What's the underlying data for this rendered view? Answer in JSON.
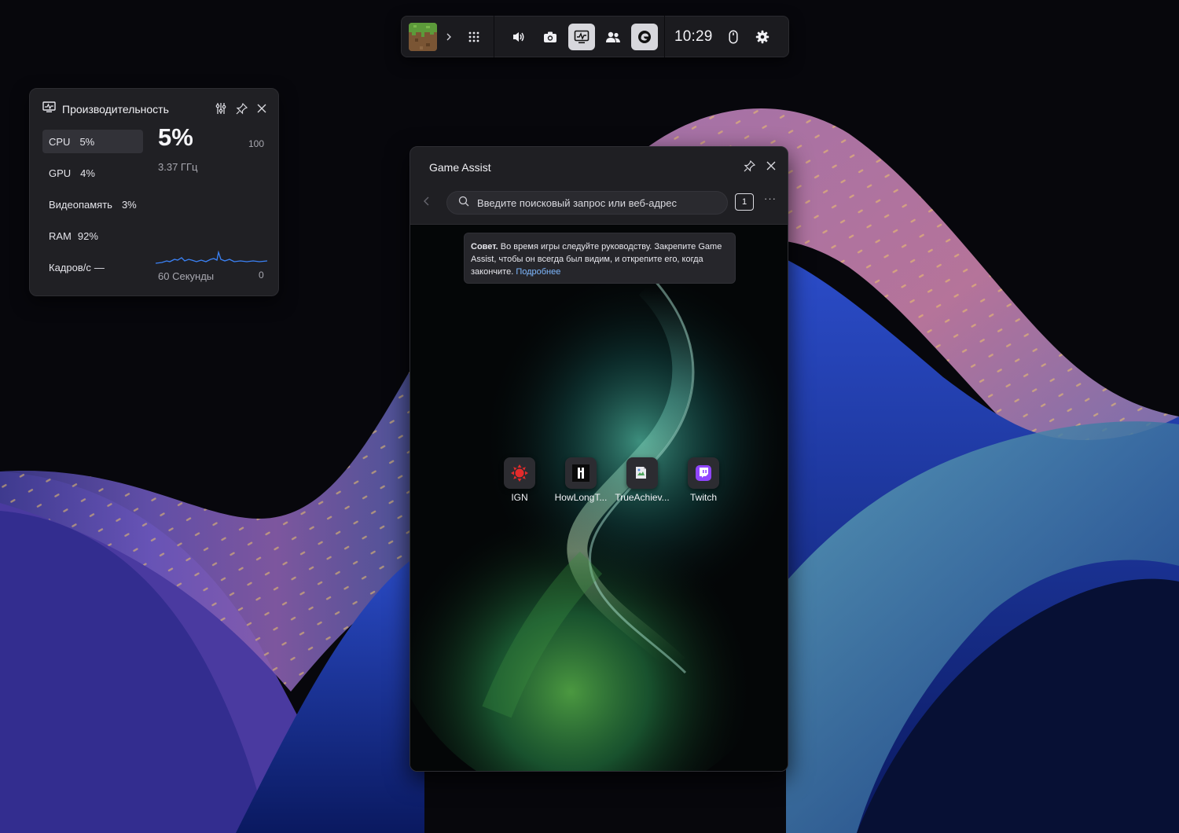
{
  "gamebar": {
    "game_icon": "minecraft-grass-block",
    "icons": [
      "chevron-right-icon",
      "widgets-menu-icon",
      "audio-icon",
      "capture-icon",
      "performance-icon",
      "social-icon",
      "game-assist-icon",
      "mouse-icon",
      "settings-icon"
    ],
    "clock": "10:29"
  },
  "performance": {
    "title": "Производительность",
    "metrics": [
      {
        "label": "CPU",
        "value": "5%"
      },
      {
        "label": "GPU",
        "value": "4%"
      },
      {
        "label": "Видеопамять",
        "value": "3%"
      },
      {
        "label": "RAM",
        "value": "92%"
      },
      {
        "label": "Кадров/с",
        "value": "—"
      }
    ],
    "selected_metric": "CPU",
    "big_value": "5%",
    "frequency": "3.37 ГГц",
    "max_label": "100",
    "window_label": "60 Секунды",
    "min_label": "0",
    "graph_color": "#3b82f6"
  },
  "assist": {
    "title": "Game Assist",
    "search_placeholder": "Введите поисковый запрос или веб-адрес",
    "tab_count": "1",
    "more": "···",
    "tip": {
      "bold": "Совет.",
      "text": " Во время игры следуйте руководству. Закрепите Game Assist, чтобы он всегда был видим, и открепите его, когда закончите. ",
      "link": "Подробнее"
    },
    "sites": [
      {
        "label": "IGN",
        "icon": "ign-icon"
      },
      {
        "label": "HowLongT...",
        "icon": "howlongtobeat-icon"
      },
      {
        "label": "TrueAchiev...",
        "icon": "trueachievements-icon"
      },
      {
        "label": "Twitch",
        "icon": "twitch-icon"
      }
    ],
    "accent": "#7eb8ff"
  }
}
